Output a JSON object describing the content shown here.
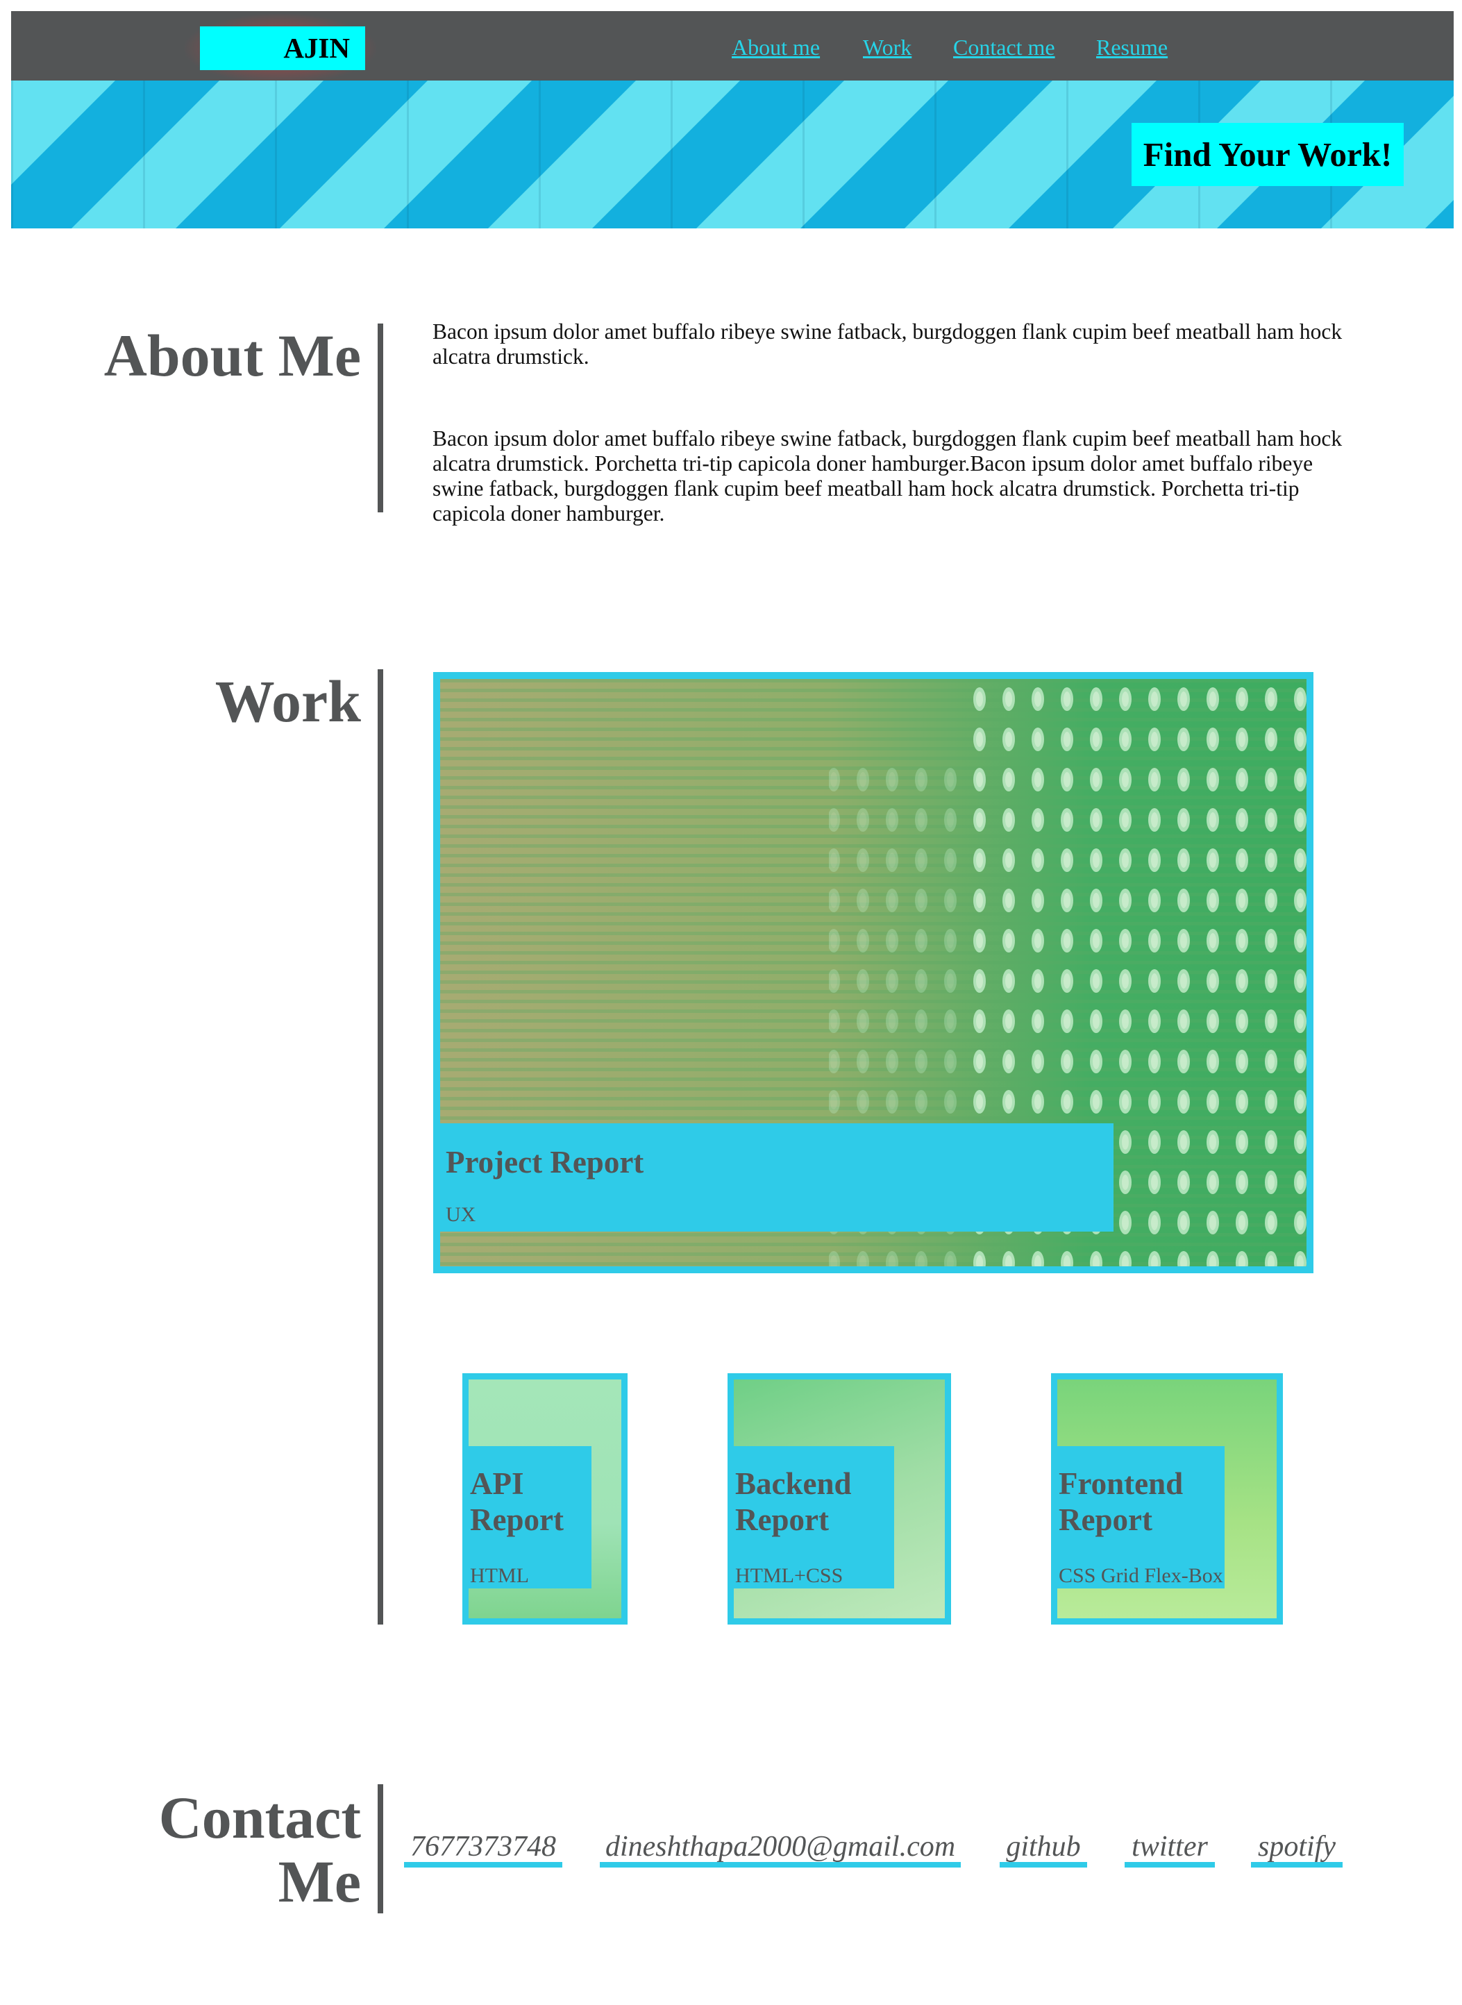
{
  "nav": {
    "logo": "AJIN",
    "links": [
      "About me",
      "Work",
      "Contact me",
      "Resume"
    ]
  },
  "hero": {
    "button": "Find Your Work!"
  },
  "about": {
    "title": "About Me",
    "paragraphs": [
      "Bacon ipsum dolor amet buffalo ribeye swine fatback, burgdoggen flank cupim beef meatball ham hock alcatra drumstick.",
      "Bacon ipsum dolor amet buffalo ribeye swine fatback, burgdoggen flank cupim beef meatball ham hock alcatra drumstick. Porchetta tri-tip capicola doner hamburger.Bacon ipsum dolor amet buffalo ribeye swine fatback, burgdoggen flank cupim beef meatball ham hock alcatra drumstick. Porchetta tri-tip capicola doner hamburger."
    ]
  },
  "work": {
    "title": "Work",
    "featured": {
      "title": "Project Report",
      "tag": "UX"
    },
    "projects": [
      {
        "title": "API Report",
        "tag": "HTML"
      },
      {
        "title": "Backend Report",
        "tag": "HTML+CSS"
      },
      {
        "title": "Frontend Report",
        "tag": "CSS Grid Flex-Box"
      }
    ]
  },
  "contact": {
    "title_line1": "Contact",
    "title_line2": "Me",
    "links": [
      "7677373748",
      "dineshthapa2000@gmail.com",
      "github",
      "twitter",
      "spotify"
    ]
  },
  "colors": {
    "nav_bg": "#535556",
    "accent_cyan": "#00ffff",
    "card_border": "#2fcbe8",
    "heading_gray": "#535556"
  }
}
